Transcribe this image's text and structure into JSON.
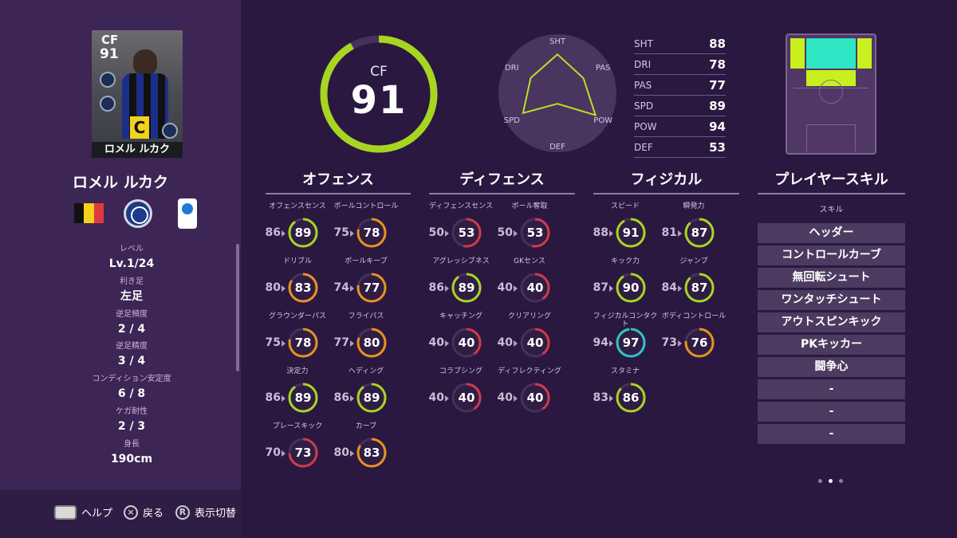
{
  "player": {
    "card_position": "CF",
    "card_overall": "91",
    "card_name": "ロメル ルカク",
    "name": "ロメル ルカク",
    "flag_colors": [
      "#111111",
      "#f2d21b",
      "#e03a3e"
    ],
    "club_icon": "club-crest-icon",
    "league_icon": "league-logo-icon"
  },
  "info": [
    {
      "label": "レベル",
      "value": "Lv.1/24"
    },
    {
      "label": "利き足",
      "value": "左足"
    },
    {
      "label": "逆足頻度",
      "value": "2 / 4"
    },
    {
      "label": "逆足精度",
      "value": "3 / 4"
    },
    {
      "label": "コンディション安定度",
      "value": "6 / 8"
    },
    {
      "label": "ケガ耐性",
      "value": "2 / 3"
    },
    {
      "label": "身長",
      "value": "190cm"
    }
  ],
  "bottom_bar": {
    "help_label": "ヘルプ",
    "back_label": "戻る",
    "back_icon": "×",
    "toggle_label": "表示切替",
    "toggle_icon": "R"
  },
  "overall": {
    "position": "CF",
    "value": 91,
    "ring_color": "#a7d621"
  },
  "radar": {
    "labels": [
      "SHT",
      "PAS",
      "POW",
      "DEF",
      "SPD",
      "DRI"
    ],
    "values": [
      88,
      77,
      94,
      53,
      89,
      78
    ],
    "line_color": "#b7e21f"
  },
  "stats": [
    {
      "label": "SHT",
      "value": "88"
    },
    {
      "label": "DRI",
      "value": "78"
    },
    {
      "label": "PAS",
      "value": "77"
    },
    {
      "label": "SPD",
      "value": "89"
    },
    {
      "label": "POW",
      "value": "94"
    },
    {
      "label": "DEF",
      "value": "53"
    }
  ],
  "position_map": {
    "strong_color": "#2de6c4",
    "medium_color": "#c8f01e"
  },
  "categories": {
    "offense": "オフェンス",
    "defense": "ディフェンス",
    "physical": "フィジカル",
    "skills": "プレイヤースキル"
  },
  "abilities": {
    "offense": [
      {
        "name": "オフェンスセンス",
        "base": "86",
        "value": "89"
      },
      {
        "name": "ボールコントロール",
        "base": "75",
        "value": "78"
      },
      {
        "name": "ドリブル",
        "base": "80",
        "value": "83"
      },
      {
        "name": "ボールキープ",
        "base": "74",
        "value": "77"
      },
      {
        "name": "グラウンダーパス",
        "base": "75",
        "value": "78"
      },
      {
        "name": "フライパス",
        "base": "77",
        "value": "80"
      },
      {
        "name": "決定力",
        "base": "86",
        "value": "89"
      },
      {
        "name": "ヘディング",
        "base": "86",
        "value": "89"
      },
      {
        "name": "プレースキック",
        "base": "70",
        "value": "73"
      },
      {
        "name": "カーブ",
        "base": "80",
        "value": "83"
      }
    ],
    "defense": [
      {
        "name": "ディフェンスセンス",
        "base": "50",
        "value": "53"
      },
      {
        "name": "ボール奪取",
        "base": "50",
        "value": "53"
      },
      {
        "name": "アグレッシブネス",
        "base": "86",
        "value": "89"
      },
      {
        "name": "GKセンス",
        "base": "40",
        "value": "40"
      },
      {
        "name": "キャッチング",
        "base": "40",
        "value": "40"
      },
      {
        "name": "クリアリング",
        "base": "40",
        "value": "40"
      },
      {
        "name": "コラプシング",
        "base": "40",
        "value": "40"
      },
      {
        "name": "ディフレクティング",
        "base": "40",
        "value": "40"
      }
    ],
    "physical": [
      {
        "name": "スピード",
        "base": "88",
        "value": "91"
      },
      {
        "name": "瞬発力",
        "base": "81",
        "value": "87"
      },
      {
        "name": "キック力",
        "base": "87",
        "value": "90"
      },
      {
        "name": "ジャンプ",
        "base": "84",
        "value": "87"
      },
      {
        "name": "フィジカルコンタクト",
        "base": "94",
        "value": "97"
      },
      {
        "name": "ボディコントロール",
        "base": "73",
        "value": "76"
      },
      {
        "name": "スタミナ",
        "base": "83",
        "value": "86"
      }
    ]
  },
  "skills_subheader": "スキル",
  "skills": [
    "ヘッダー",
    "コントロールカーブ",
    "無回転シュート",
    "ワンタッチシュート",
    "アウトスピンキック",
    "PKキッカー",
    "闘争心",
    "-",
    "-",
    "-"
  ],
  "ring_colors": {
    "red": "#d13a4a",
    "orange": "#e8931f",
    "green": "#a7d621",
    "teal": "#2ec4c4",
    "track": "#47305c"
  },
  "pagination": {
    "total": 3,
    "active": 1
  }
}
